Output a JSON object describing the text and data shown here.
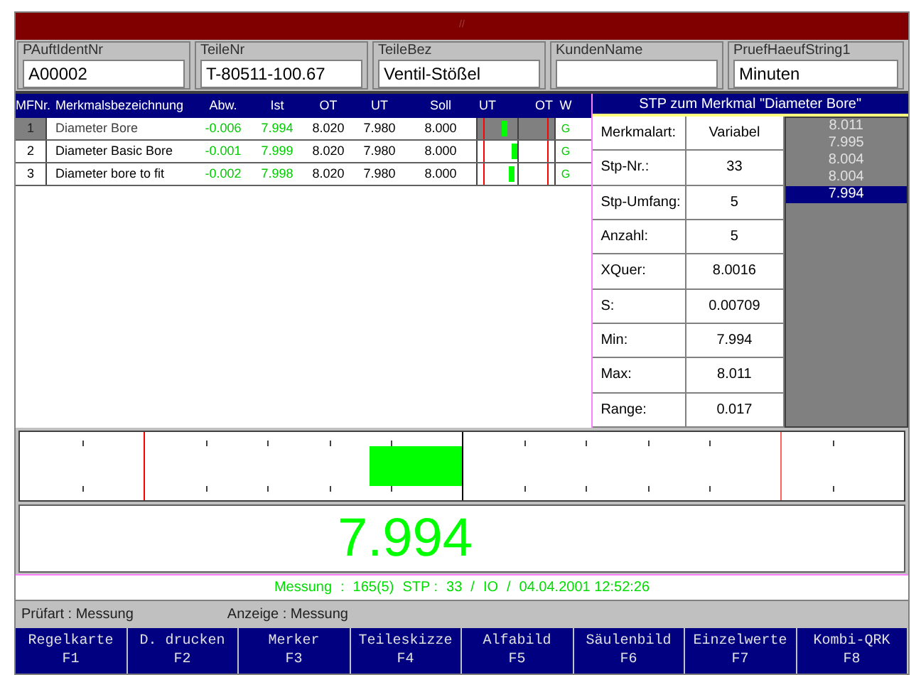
{
  "window": {
    "title": "//"
  },
  "fields": [
    {
      "label": "PAuftIdentNr",
      "value": "A00002"
    },
    {
      "label": "TeileNr",
      "value": "T-80511-100.67"
    },
    {
      "label": "TeileBez",
      "value": "Ventil-Stößel"
    },
    {
      "label": "KundenName"
    },
    {
      "label": "PruefHaeufString1",
      "value": "Minuten"
    }
  ],
  "table": {
    "columns": [
      "MFNr.",
      "Merkmalsbezeichnung",
      "Abw.",
      "Ist",
      "OT",
      "UT",
      "Soll",
      "UT",
      "OT",
      "W"
    ],
    "rows": [
      {
        "selected": true,
        "cells": [
          "1",
          "Diameter Bore",
          "-0.006",
          "7.994",
          "8.020",
          "7.980",
          "8.000"
        ],
        "level": 0.35,
        "w": "G"
      },
      {
        "selected": false,
        "cells": [
          "2",
          "Diameter Basic Bore",
          "-0.001",
          "7.999",
          "8.020",
          "7.980",
          "8.000"
        ],
        "level": 0.48,
        "w": "G"
      },
      {
        "selected": false,
        "cells": [
          "3",
          "Diameter bore to fit",
          "-0.002",
          "7.998",
          "8.020",
          "7.980",
          "8.000"
        ],
        "level": 0.45,
        "w": "G"
      }
    ]
  },
  "stp_panel": {
    "title": "STP zum Merkmal \"Diameter Bore\"",
    "stats": [
      {
        "label": "Merkmalart:",
        "value": "Variabel"
      },
      {
        "label": "Stp-Nr.:",
        "value": "33"
      },
      {
        "label": "Stp-Umfang:",
        "value": "5"
      },
      {
        "label": "Anzahl:",
        "value": "5"
      },
      {
        "label": "XQuer:",
        "value": "8.0016"
      },
      {
        "label": "S:",
        "value": "0.00709"
      },
      {
        "label": "Min:",
        "value": "7.994"
      },
      {
        "label": "Max:",
        "value": "8.011"
      },
      {
        "label": "Range:",
        "value": "0.017"
      }
    ],
    "values": [
      {
        "text": "8.011",
        "selected": false
      },
      {
        "text": "7.995",
        "selected": false
      },
      {
        "text": "8.004",
        "selected": false
      },
      {
        "text": "8.004",
        "selected": false
      },
      {
        "text": "7.994",
        "selected": true
      }
    ]
  },
  "gauge": {
    "level": 0.396
  },
  "current_value": "7.994",
  "measure_line": [
    "Messung",
    ":",
    "165(5)",
    "STP :",
    "33",
    "/",
    "IO",
    "/",
    "04.04.2001 12:52:26"
  ],
  "info_bar": [
    "Prüfart : Messung",
    "Anzeige : Messung"
  ],
  "function_keys": [
    {
      "label": "Regelkarte",
      "key": "F1"
    },
    {
      "label": "D. drucken",
      "key": "F2"
    },
    {
      "label": "Merker",
      "key": "F3"
    },
    {
      "label": "Teileskizze",
      "key": "F4"
    },
    {
      "label": "Alfabild",
      "key": "F5"
    },
    {
      "label": "Säulenbild",
      "key": "F6"
    },
    {
      "label": "Einzelwerte",
      "key": "F7"
    },
    {
      "label": "Kombi-QRK",
      "key": "F8"
    }
  ]
}
